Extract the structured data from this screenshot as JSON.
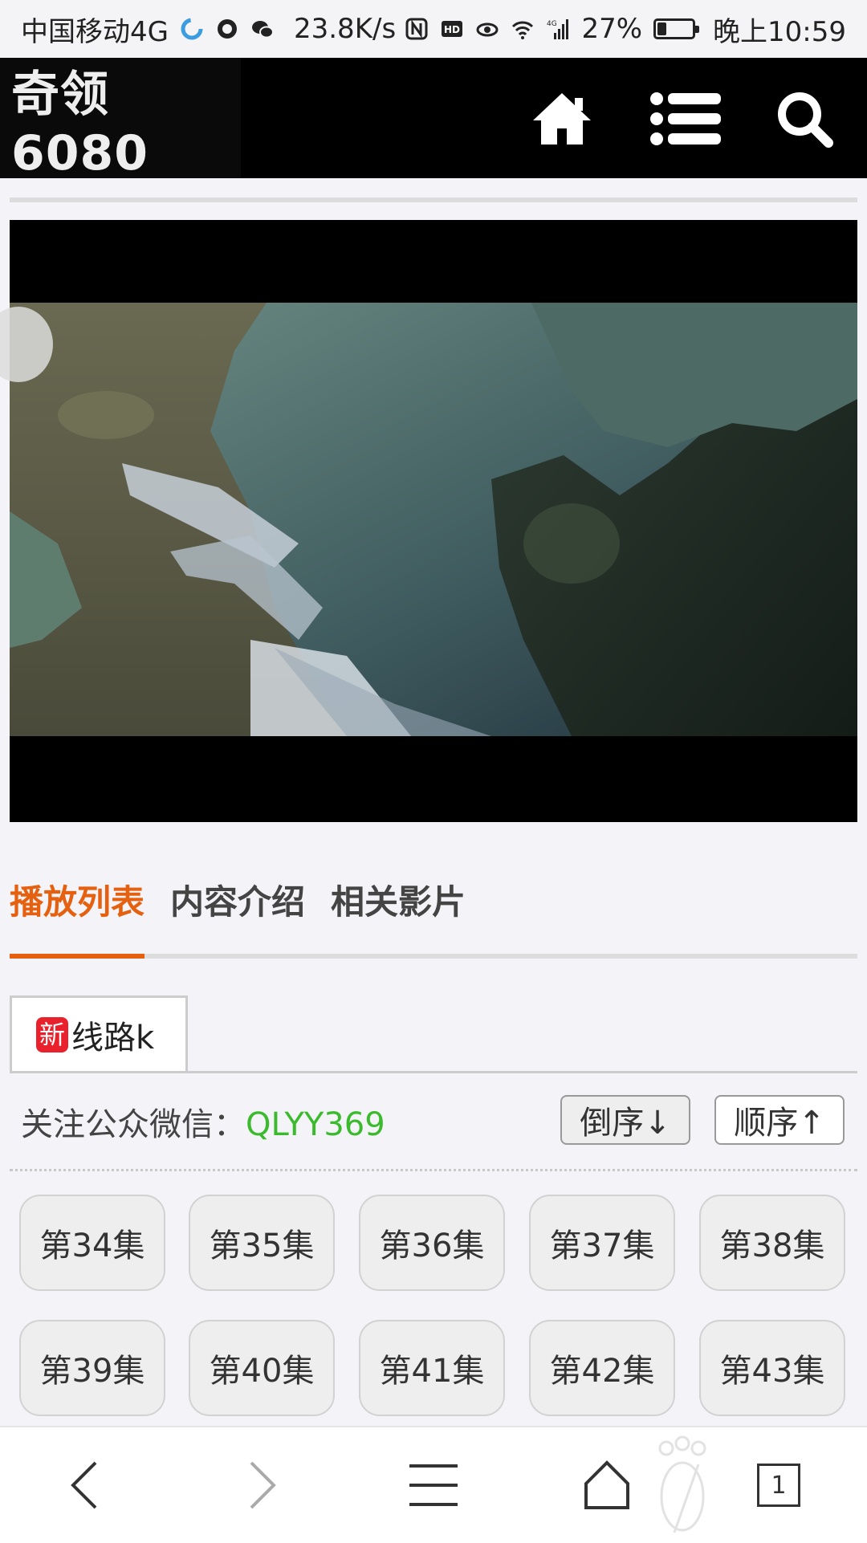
{
  "status_bar": {
    "carrier": "中国移动4G",
    "speed": "23.8K/s",
    "network": "4G",
    "battery": "27%",
    "battery_level": 0.27,
    "time": "晚上10:59"
  },
  "header": {
    "logo": "奇领6080",
    "icons": [
      "home-icon",
      "menu-icon",
      "search-icon"
    ]
  },
  "tabs": [
    {
      "label": "播放列表",
      "active": true
    },
    {
      "label": "内容介绍",
      "active": false
    },
    {
      "label": "相关影片",
      "active": false
    }
  ],
  "route": {
    "badge": "新",
    "label": "线路k"
  },
  "follow": {
    "prefix": "关注公众微信：",
    "code": "QLYY369"
  },
  "sort": {
    "desc": "倒序↓",
    "asc": "顺序↑"
  },
  "episodes": [
    "第34集",
    "第35集",
    "第36集",
    "第37集",
    "第38集",
    "第39集",
    "第40集",
    "第41集",
    "第42集",
    "第43集"
  ],
  "bottom_nav": {
    "icons": [
      "back-icon",
      "forward-icon",
      "menu-icon",
      "home-icon",
      "tabs-icon"
    ],
    "tab_count": "1"
  },
  "colors": {
    "accent": "#e5600f",
    "wechat_code": "#3aba2c",
    "new_badge": "#e8212c"
  }
}
